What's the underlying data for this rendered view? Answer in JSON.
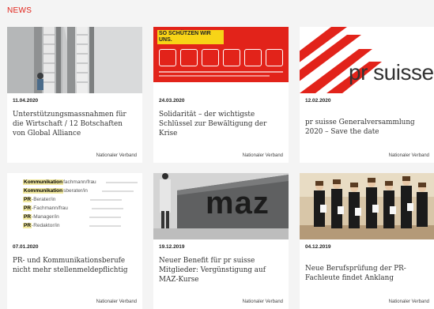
{
  "section": {
    "title": "NEWS"
  },
  "articles": [
    {
      "date": "11.04.2020",
      "headline": "Unterstützungsmassnahmen für die Wirtschaft / 12 Botschaften von Global Alliance",
      "category": "Nationaler Verband",
      "image": "escalator-photo"
    },
    {
      "date": "24.03.2020",
      "headline": "Solidarität – der wichtigste Schlüssel zur Bewältigung der Krise",
      "category": "Nationaler Verband",
      "image": "so-schuetzen-wir-uns-poster",
      "image_text": "SO SCHÜTZEN WIR UNS."
    },
    {
      "date": "12.02.2020",
      "headline": "pr suisse Generalversammlung 2020 – Save the date",
      "category": "Nationaler Verband",
      "image": "pr-suisse-logo",
      "image_text": "pr suisse"
    },
    {
      "date": "07.01.2020",
      "headline": "PR- und Kommunikationsberufe nicht mehr stellenmeldepflichtig",
      "category": "Nationaler Verband",
      "image": "job-title-list",
      "image_lines": [
        {
          "label": "Kommunikation",
          "suffix": "fachmann/frau"
        },
        {
          "label": "Kommunikation",
          "suffix": "sberater/in"
        },
        {
          "label": "PR",
          "suffix": "-Berater/in"
        },
        {
          "label": "PR",
          "suffix": "-Fachmann/frau"
        },
        {
          "label": "PR",
          "suffix": "-Manager/in"
        },
        {
          "label": "PR",
          "suffix": "-Redaktor/in"
        }
      ]
    },
    {
      "date": "19.12.2019",
      "headline": "Neuer Benefit für pr suisse Mitglieder: Vergünstigung auf MAZ-Kurse",
      "category": "Nationaler Verband",
      "image": "maz-sign-photo",
      "image_text": "maz"
    },
    {
      "date": "04.12.2019",
      "headline": "Neue Berufsprüfung der PR-Fachleute findet Anklang",
      "category": "Nationaler Verband",
      "image": "graduates-group-photo"
    }
  ],
  "colors": {
    "accent": "#e2231a",
    "background": "#f4f4f4",
    "card": "#ffffff"
  }
}
